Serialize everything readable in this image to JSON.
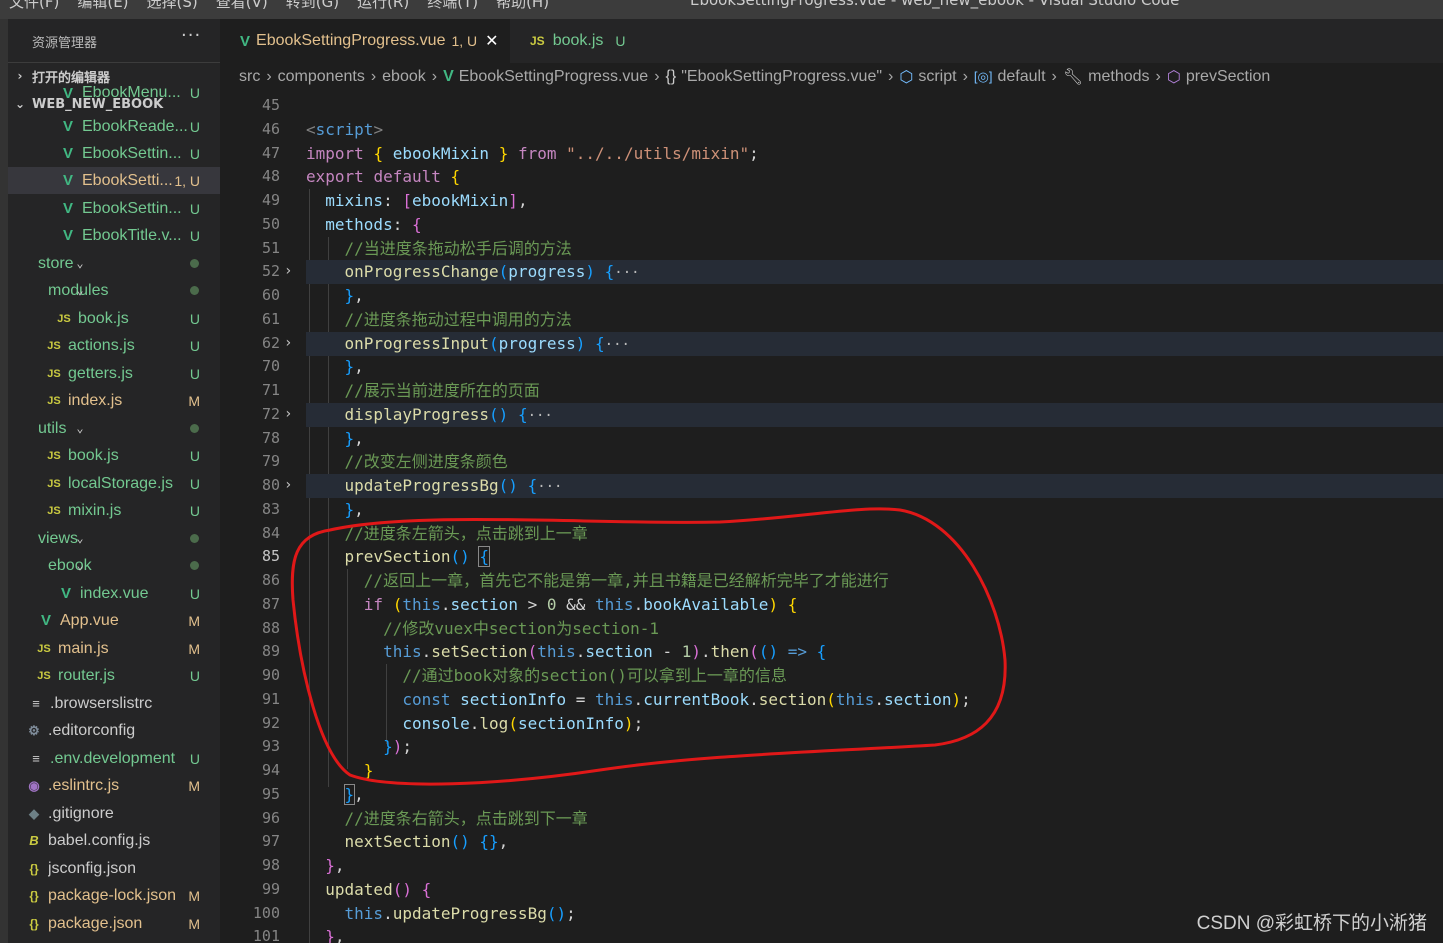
{
  "window": {
    "menu": [
      "文件(F)",
      "编辑(E)",
      "选择(S)",
      "查看(V)",
      "转到(G)",
      "运行(R)",
      "终端(T)",
      "帮助(H)"
    ],
    "title": "EbookSettingProgress.vue - web_new_ebook - Visual Studio Code"
  },
  "sidebar": {
    "title": "资源管理器",
    "more": "···",
    "open_editors": "打开的编辑器",
    "project": "WEB_NEW_EBOOK",
    "items": [
      {
        "label": "EbookMenu...",
        "status": "U",
        "icon": "vue-icon"
      },
      {
        "label": "EbookReade...",
        "status": "U",
        "icon": "vue-icon"
      },
      {
        "label": "EbookSettin...",
        "status": "U",
        "icon": "vue-icon"
      },
      {
        "label": "EbookSetti...",
        "status": "1, U",
        "icon": "vue-icon"
      },
      {
        "label": "EbookSettin...",
        "status": "U",
        "icon": "vue-icon"
      },
      {
        "label": "EbookTitle.v...",
        "status": "U",
        "icon": "vue-icon"
      },
      {
        "label": "store",
        "status": "",
        "icon": "folder-open"
      },
      {
        "label": "modules",
        "status": "",
        "icon": "folder-open"
      },
      {
        "label": "book.js",
        "status": "U",
        "icon": "js-icon"
      },
      {
        "label": "actions.js",
        "status": "U",
        "icon": "js-icon"
      },
      {
        "label": "getters.js",
        "status": "U",
        "icon": "js-icon"
      },
      {
        "label": "index.js",
        "status": "M",
        "icon": "js-icon"
      },
      {
        "label": "utils",
        "status": "",
        "icon": "folder-open"
      },
      {
        "label": "book.js",
        "status": "U",
        "icon": "js-icon"
      },
      {
        "label": "localStorage.js",
        "status": "U",
        "icon": "js-icon"
      },
      {
        "label": "mixin.js",
        "status": "U",
        "icon": "js-icon"
      },
      {
        "label": "views",
        "status": "",
        "icon": "folder-open"
      },
      {
        "label": "ebook",
        "status": "",
        "icon": "folder-open"
      },
      {
        "label": "index.vue",
        "status": "U",
        "icon": "vue-icon"
      },
      {
        "label": "App.vue",
        "status": "M",
        "icon": "vue-icon"
      },
      {
        "label": "main.js",
        "status": "M",
        "icon": "js-icon"
      },
      {
        "label": "router.js",
        "status": "U",
        "icon": "js-icon"
      },
      {
        "label": ".browserslistrc",
        "status": "",
        "icon": "text-icon"
      },
      {
        "label": ".editorconfig",
        "status": "",
        "icon": "gear-icon"
      },
      {
        "label": ".env.development",
        "status": "U",
        "icon": "text-icon"
      },
      {
        "label": ".eslintrc.js",
        "status": "M",
        "icon": "eslint-icon"
      },
      {
        "label": ".gitignore",
        "status": "",
        "icon": "git-icon"
      },
      {
        "label": "babel.config.js",
        "status": "",
        "icon": "babel-icon"
      },
      {
        "label": "jsconfig.json",
        "status": "",
        "icon": "json-icon"
      },
      {
        "label": "package-lock.json",
        "status": "M",
        "icon": "json-icon"
      },
      {
        "label": "package.json",
        "status": "M",
        "icon": "json-icon"
      }
    ]
  },
  "tabs": [
    {
      "label": "EbookSettingProgress.vue",
      "status": "1, U",
      "close": "✕"
    },
    {
      "label": "book.js",
      "status": "U"
    }
  ],
  "breadcrumbs": [
    "src",
    "components",
    "ebook",
    "EbookSettingProgress.vue",
    "\"EbookSettingProgress.vue\"",
    "script",
    "default",
    "methods",
    "prevSection"
  ],
  "editor": {
    "line_numbers": [
      "45",
      "46",
      "47",
      "48",
      "49",
      "50",
      "51",
      "52",
      "60",
      "61",
      "62",
      "70",
      "71",
      "72",
      "78",
      "79",
      "80",
      "83",
      "84",
      "85",
      "86",
      "87",
      "88",
      "89",
      "90",
      "91",
      "92",
      "93",
      "94",
      "95",
      "96",
      "97",
      "98",
      "99",
      "100",
      "101"
    ],
    "current_line": "85"
  },
  "watermark": "CSDN @彩虹桥下的小淅猪"
}
